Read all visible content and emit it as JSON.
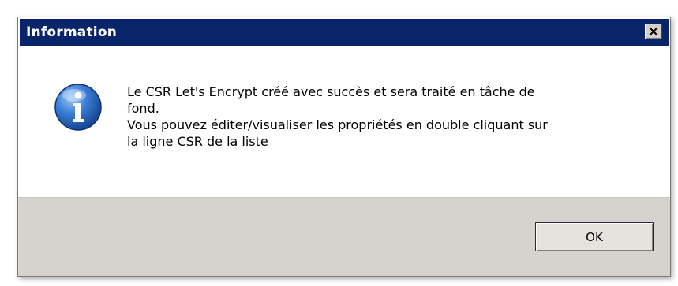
{
  "dialog": {
    "title": "Information",
    "icon": "info-icon",
    "message_lines": [
      "Le CSR Let's Encrypt créé avec succès et sera traité en tâche de",
      "fond.",
      "Vous pouvez éditer/visualiser les propriétés en double cliquant sur",
      "la ligne CSR de la liste"
    ],
    "close_glyph": "✕",
    "ok_label": "OK"
  },
  "colors": {
    "titlebar": "#0a246a",
    "footer": "#d6d3ce",
    "icon_blue": "#1f5fb8"
  }
}
